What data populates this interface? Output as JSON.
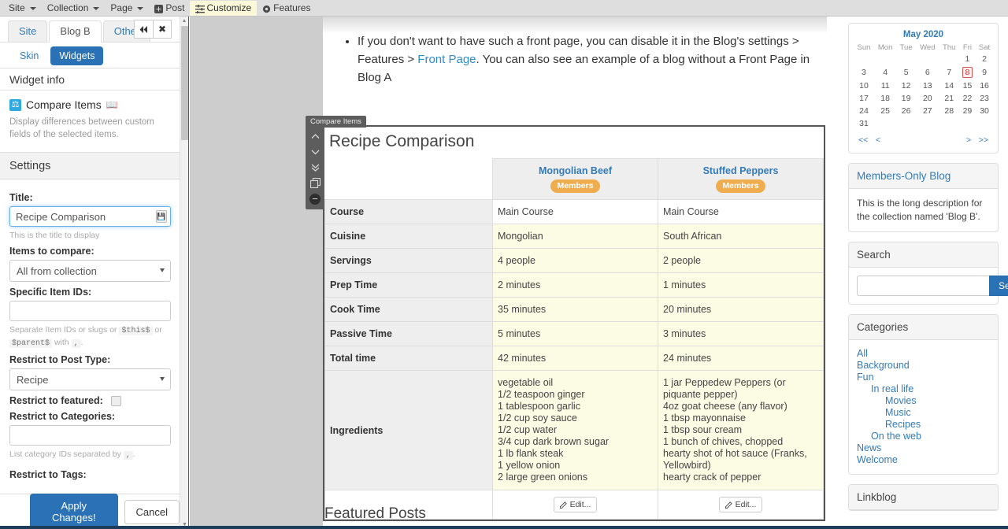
{
  "topbar": {
    "items": [
      {
        "label": "Site",
        "icon": "caret-down-icon",
        "caret": true,
        "highlight": false
      },
      {
        "label": "Collection",
        "icon": "caret-down-icon",
        "caret": true,
        "highlight": false
      },
      {
        "label": "Page",
        "icon": "caret-down-icon",
        "caret": true,
        "highlight": false
      },
      {
        "label": "Post",
        "icon": "plus-square-icon",
        "caret": false,
        "highlight": false
      },
      {
        "label": "Customize",
        "icon": "sliders-icon",
        "caret": false,
        "highlight": true
      },
      {
        "label": "Features",
        "icon": "gear-icon",
        "caret": false,
        "highlight": false
      }
    ]
  },
  "left_panel": {
    "tabs": [
      {
        "label": "Site",
        "active": false
      },
      {
        "label": "Blog B",
        "active": true
      },
      {
        "label": "Other",
        "active": false
      }
    ],
    "tab_buttons": [
      {
        "name": "collapse-button",
        "glyph": "◀◀"
      },
      {
        "name": "close-button",
        "glyph": "✖"
      }
    ],
    "subtabs": [
      {
        "label": "Skin",
        "active": false
      },
      {
        "label": "Widgets",
        "active": true
      }
    ],
    "widget_info_heading": "Widget info",
    "widget_name": "Compare Items",
    "widget_description": "Display differences between custom fields of the selected items.",
    "settings_heading": "Settings",
    "fields": {
      "title_label": "Title:",
      "title_value": "Recipe Comparison",
      "title_help": "This is the title to display",
      "items_label": "Items to compare:",
      "items_value": "All from collection",
      "specific_label": "Specific Item IDs:",
      "specific_value": "",
      "specific_help_1": "Separate Item IDs or slugs or",
      "specific_help_code1": "$this$",
      "specific_help_2": "or",
      "specific_help_code2": "$parent$",
      "specific_help_3": "with",
      "specific_help_code3": ",",
      "specific_help_4": ".",
      "posttype_label": "Restrict to Post Type:",
      "posttype_value": "Recipe",
      "featured_label": "Restrict to featured:",
      "categories_label": "Restrict to Categories:",
      "categories_value": "",
      "categories_help_1": "List category IDs separated by",
      "categories_help_code": ",",
      "categories_help_2": ".",
      "tags_label": "Restrict to Tags:"
    },
    "apply_label": "Apply Changes!",
    "cancel_label": "Cancel"
  },
  "content": {
    "bullet_text_1": "If you don't want to have such a front page, you can disable it in the Blog's settings > Features > ",
    "bullet_link": "Front Page",
    "bullet_text_2": ". You can also see an example of a blog without a Front Page in Blog A",
    "featured_posts_title": "Featured Posts"
  },
  "widget": {
    "tag_label": "Compare Items",
    "tools": [
      {
        "name": "move-up-icon",
        "glyph": "⌃"
      },
      {
        "name": "move-down-icon",
        "glyph": "⌄"
      },
      {
        "name": "move-bottom-icon",
        "glyph": "»"
      },
      {
        "name": "duplicate-icon",
        "glyph": "⧉"
      },
      {
        "name": "remove-icon",
        "glyph": "−"
      }
    ],
    "title": "Recipe Comparison",
    "edit_label": "Edit...",
    "members_badge": "Members"
  },
  "chart_data": {
    "type": "table",
    "title": "Recipe Comparison",
    "columns": [
      "",
      "Mongolian Beef",
      "Stuffed Peppers"
    ],
    "column_badges": [
      "",
      "Members",
      "Members"
    ],
    "rows": [
      {
        "label": "Course",
        "diff": false,
        "values": [
          "Main Course",
          "Main Course"
        ]
      },
      {
        "label": "Cuisine",
        "diff": true,
        "values": [
          "Mongolian",
          "South African"
        ]
      },
      {
        "label": "Servings",
        "diff": true,
        "values": [
          "4 people",
          "2 people"
        ]
      },
      {
        "label": "Prep Time",
        "diff": true,
        "values": [
          "2 minutes",
          "1 minutes"
        ]
      },
      {
        "label": "Cook Time",
        "diff": true,
        "values": [
          "35 minutes",
          "20 minutes"
        ]
      },
      {
        "label": "Passive Time",
        "diff": true,
        "values": [
          "5 minutes",
          "3 minutes"
        ]
      },
      {
        "label": "Total time",
        "diff": true,
        "values": [
          "42 minutes",
          "24 minutes"
        ]
      },
      {
        "label": "Ingredients",
        "diff": true,
        "multiline": true,
        "values_lines": [
          [
            "vegetable oil",
            "1/2 teaspoon ginger",
            "1 tablespoon garlic",
            "1/2 cup soy sauce",
            "1/2 cup water",
            "3/4 cup dark brown sugar",
            "1 lb flank steak",
            "1 yellow onion",
            "2 large green onions"
          ],
          [
            "1 jar Peppedew Peppers (or piquante pepper)",
            "4oz goat cheese (any flavor)",
            "1 tbsp mayonnaise",
            "1 tbsp sour cream",
            "1 bunch of chives, chopped",
            "hearty shot of hot sauce (Franks, Yellowbird)",
            "hearty crack of pepper"
          ]
        ]
      }
    ]
  },
  "sidebar": {
    "calendar": {
      "title": "May 2020",
      "daynames": [
        "Sun",
        "Mon",
        "Tue",
        "Wed",
        "Thu",
        "Fri",
        "Sat"
      ],
      "weeks": [
        [
          "",
          "",
          "",
          "",
          "",
          "1",
          "2"
        ],
        [
          "3",
          "4",
          "5",
          "6",
          "7",
          "8",
          "9"
        ],
        [
          "10",
          "11",
          "12",
          "13",
          "14",
          "15",
          "16"
        ],
        [
          "17",
          "18",
          "19",
          "20",
          "21",
          "22",
          "23"
        ],
        [
          "24",
          "25",
          "26",
          "27",
          "28",
          "29",
          "30"
        ],
        [
          "31",
          "",
          "",
          "",
          "",
          "",
          ""
        ]
      ],
      "today": "8",
      "nav": {
        "first": "<<",
        "prev": "<",
        "next": ">",
        "last": ">>"
      }
    },
    "members_blog": {
      "heading": "Members-Only Blog",
      "description": "This is the long description for the collection named 'Blog B'."
    },
    "search": {
      "heading": "Search",
      "value": "",
      "placeholder": "",
      "button_label": "Search"
    },
    "categories": {
      "heading": "Categories",
      "items": [
        {
          "label": "All",
          "depth": 0
        },
        {
          "label": "Background",
          "depth": 0
        },
        {
          "label": "Fun",
          "depth": 0
        },
        {
          "label": "In real life",
          "depth": 1
        },
        {
          "label": "Movies",
          "depth": 2
        },
        {
          "label": "Music",
          "depth": 2
        },
        {
          "label": "Recipes",
          "depth": 2
        },
        {
          "label": "On the web",
          "depth": 1
        },
        {
          "label": "News",
          "depth": 0
        },
        {
          "label": "Welcome",
          "depth": 0
        }
      ]
    },
    "linkblog": {
      "heading": "Linkblog"
    }
  },
  "colors": {
    "link": "#337ab7",
    "primary": "#2a72b5",
    "badge_orange": "#f0ad4e",
    "diff_row": "#fcfbe3",
    "highlight_menu": "#fbf8d8"
  }
}
